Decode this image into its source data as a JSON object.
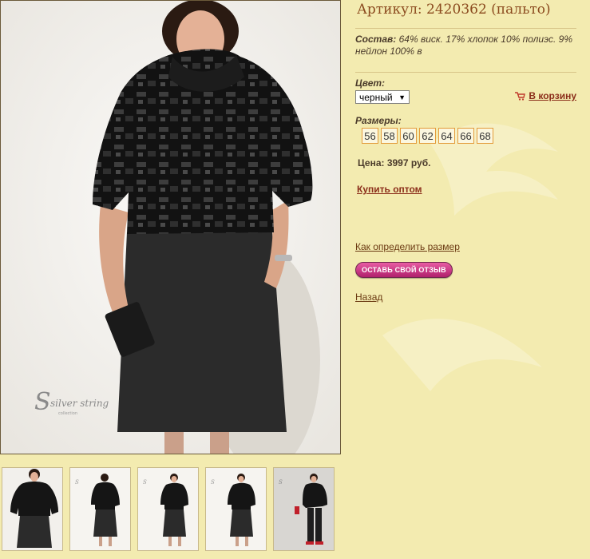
{
  "product": {
    "title": "Артикул: 2420362 (пальто)",
    "composition_label": "Состав:",
    "composition_text": " 64% виск. 17% хлопок 10% полиэс. 9% нейлон 100% в",
    "color_label": "Цвет:",
    "color_value": "черный",
    "cart_link": "В корзину",
    "sizes_label": "Размеры:",
    "sizes": [
      "56",
      "58",
      "60",
      "62",
      "64",
      "66",
      "68"
    ],
    "price": "Цена: 3997 руб.",
    "wholesale_link": "Купить оптом",
    "size_help_link": "Как определить размер",
    "review_button": "ОСТАВЬ СВОЙ ОТЗЫВ",
    "back_link": "Назад"
  },
  "photo": {
    "watermark_brand": "silver string",
    "watermark_sub": "collection"
  },
  "thumbnails": [
    {
      "name": "thumb-front-closeup"
    },
    {
      "name": "thumb-back"
    },
    {
      "name": "thumb-front-full"
    },
    {
      "name": "thumb-front-full-2"
    },
    {
      "name": "thumb-other-outfit"
    }
  ],
  "colors": {
    "background": "#f3ebb0",
    "title": "#8b4a1e",
    "link": "#8b2e1a",
    "size_border": "#e39b3a",
    "review_button": "#d63f8d"
  }
}
